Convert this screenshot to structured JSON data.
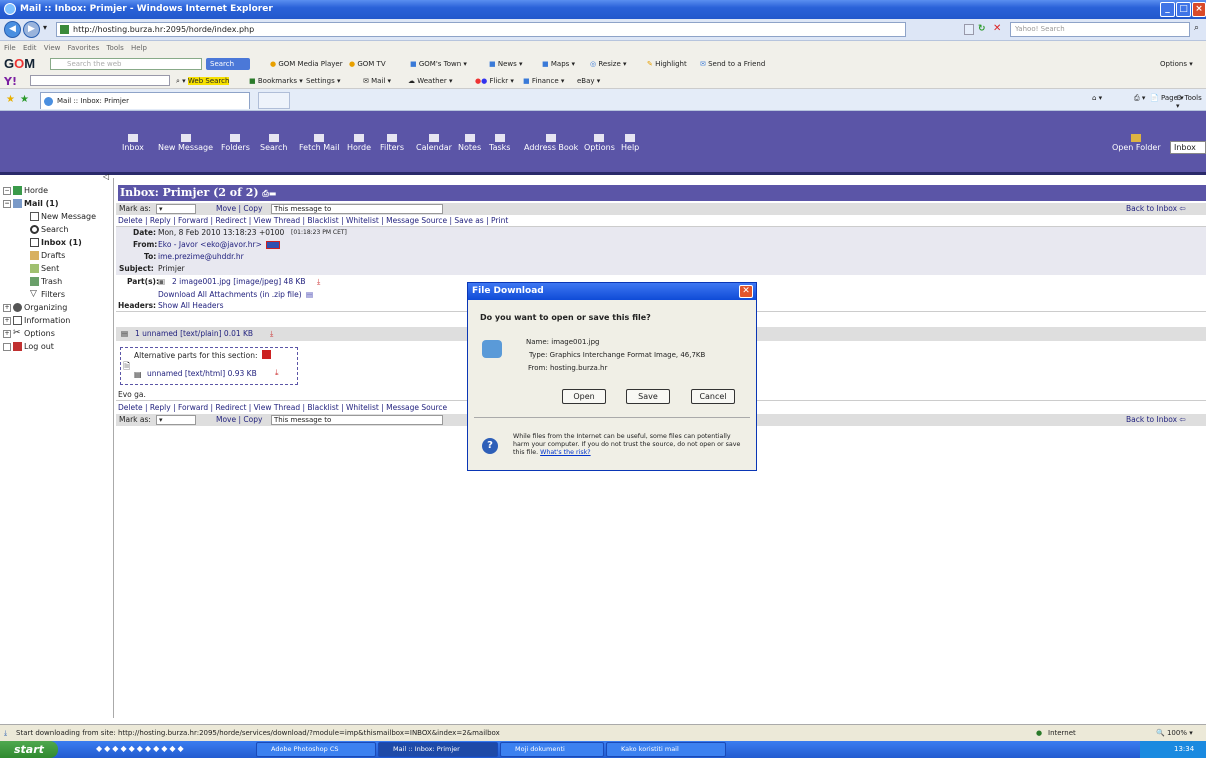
{
  "window": {
    "title": "Mail :: Inbox: Primjer - Windows Internet Explorer"
  },
  "addressbar": {
    "url": "http://hosting.burza.hr:2095/horde/index.php",
    "search_placeholder": "Yahoo! Search"
  },
  "menubar": {
    "items": [
      "File",
      "Edit",
      "View",
      "Favorites",
      "Tools",
      "Help"
    ]
  },
  "gom_toolbar": {
    "search_placeholder": "Search the web",
    "search_label": "Search",
    "items": [
      "GOM Media Player",
      "GOM TV",
      "GOM's Town",
      "News",
      "Maps",
      "Resize",
      "Highlight",
      "Send to a Friend"
    ],
    "options_label": "Options"
  },
  "yahoo_toolbar": {
    "items": [
      "Web Search",
      "Bookmarks",
      "Settings",
      "Mail",
      "Weather",
      "Flickr",
      "Finance",
      "eBay"
    ]
  },
  "tab": {
    "label": "Mail :: Inbox: Primjer"
  },
  "command_bar": {
    "items": [
      "Page",
      "Tools"
    ]
  },
  "horde_nav": {
    "items": [
      "Inbox",
      "New Message",
      "Folders",
      "Search",
      "Fetch Mail",
      "Horde",
      "Filters",
      "Calendar",
      "Notes",
      "Tasks",
      "Address Book",
      "Options",
      "Help"
    ],
    "open_folder": "Open Folder",
    "folder_select": "Inbox"
  },
  "sidebar": {
    "horde": "Horde",
    "mail": "Mail (1)",
    "new_message": "New Message",
    "search": "Search",
    "inbox": "Inbox (1)",
    "drafts": "Drafts",
    "sent": "Sent",
    "trash": "Trash",
    "filters": "Filters",
    "organizing": "Organizing",
    "information": "Information",
    "options": "Options",
    "logout": "Log out"
  },
  "message": {
    "heading": "Inbox: Primjer (2 of 2)",
    "mark_as": "Mark as:",
    "move_copy": "Move | Copy",
    "move_target": "This message to",
    "back_to_inbox": "Back to Inbox",
    "actions": "Delete | Reply | Forward | Redirect | View Thread | Blacklist | Whitelist | Message Source | Save as | Print",
    "actions_cut": "Delete | Reply | Forward | Redirect | View Thread | Blacklist | Whitelist | Message Source",
    "date_label": "Date:",
    "date": "Mon, 8 Feb 2010 13:18:23 +0100",
    "date_local": "[01:18:23 PM CET]",
    "from_label": "From:",
    "from": "Eko - Javor <eko@javor.hr>",
    "to_label": "To:",
    "to": "ime.prezime@uhddr.hr",
    "subject_label": "Subject:",
    "subject": "Primjer",
    "parts_label": "Part(s):",
    "part": "2 image001.jpg [image/jpeg] 48 KB",
    "download_all": "Download All Attachments (in .zip file)",
    "headers_label": "Headers:",
    "show_all_headers": "Show All Headers",
    "part1": "1 unnamed [text/plain] 0.01 KB",
    "alt_parts": "Alternative parts for this section:",
    "alt_part": "unnamed [text/html] 0.93 KB",
    "body": "Evo ga."
  },
  "dialog": {
    "title": "File Download",
    "question": "Do you want to open or save this file?",
    "name_label": "Name:",
    "name": "image001.jpg",
    "type_label": "Type:",
    "type": "Graphics Interchange Format Image, 46,7KB",
    "from_label": "From:",
    "from": "hosting.burza.hr",
    "open": "Open",
    "save": "Save",
    "cancel": "Cancel",
    "warning": "While files from the Internet can be useful, some files can potentially harm your computer. If you do not trust the source, do not open or save this file.",
    "risk_link": "What's the risk?"
  },
  "statusbar": {
    "text": "Start downloading from site: http://hosting.burza.hr:2095/horde/services/download/?module=imp&thismailbox=INBOX&index=2&mailbox",
    "zone": "Internet",
    "zoom": "100%"
  },
  "taskbar": {
    "start": "start",
    "items": [
      "Adobe Photoshop CS",
      "Mail :: Inbox: Primjer",
      "Moji dokumenti",
      "Kako koristiti mail"
    ],
    "clock": "13:34"
  }
}
